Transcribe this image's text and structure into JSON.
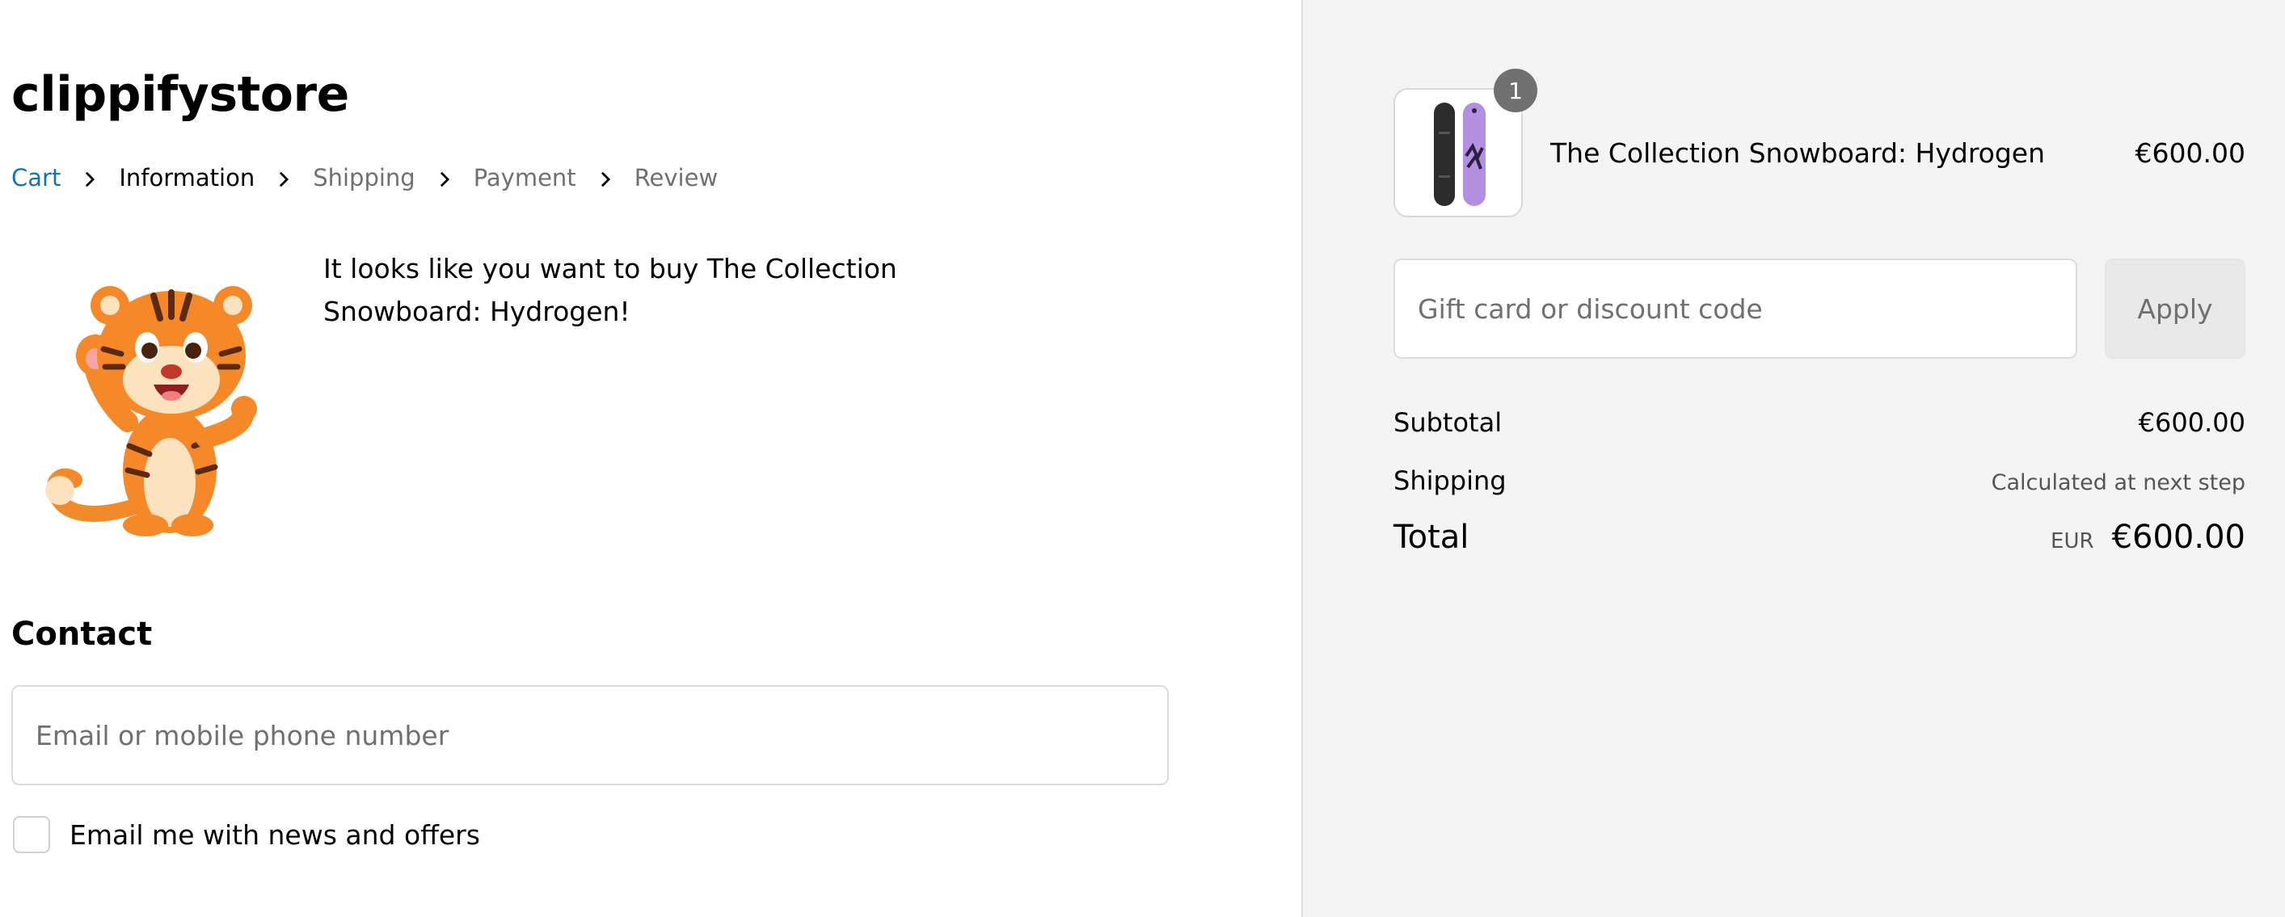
{
  "store": {
    "name": "clippifystore"
  },
  "breadcrumb": {
    "cart": "Cart",
    "information": "Information",
    "shipping": "Shipping",
    "payment": "Payment",
    "review": "Review"
  },
  "promo": {
    "message": "It looks like you want to buy The Collection Snowboard: Hydrogen!"
  },
  "contact": {
    "heading": "Contact",
    "email_placeholder": "Email or mobile phone number",
    "email_value": "",
    "newsletter_label": "Email me with news and offers",
    "newsletter_checked": false
  },
  "order": {
    "item": {
      "name": "The Collection Snowboard: Hydrogen",
      "price": "€600.00",
      "quantity": "1"
    },
    "discount": {
      "placeholder": "Gift card or discount code",
      "value": "",
      "apply_label": "Apply"
    },
    "summary": {
      "subtotal_label": "Subtotal",
      "subtotal_value": "€600.00",
      "shipping_label": "Shipping",
      "shipping_value": "Calculated at next step",
      "total_label": "Total",
      "currency": "EUR",
      "total_value": "€600.00"
    }
  },
  "colors": {
    "link": "#1773b0",
    "sidebar_bg": "#f4f4f4",
    "muted_text": "#707070"
  }
}
